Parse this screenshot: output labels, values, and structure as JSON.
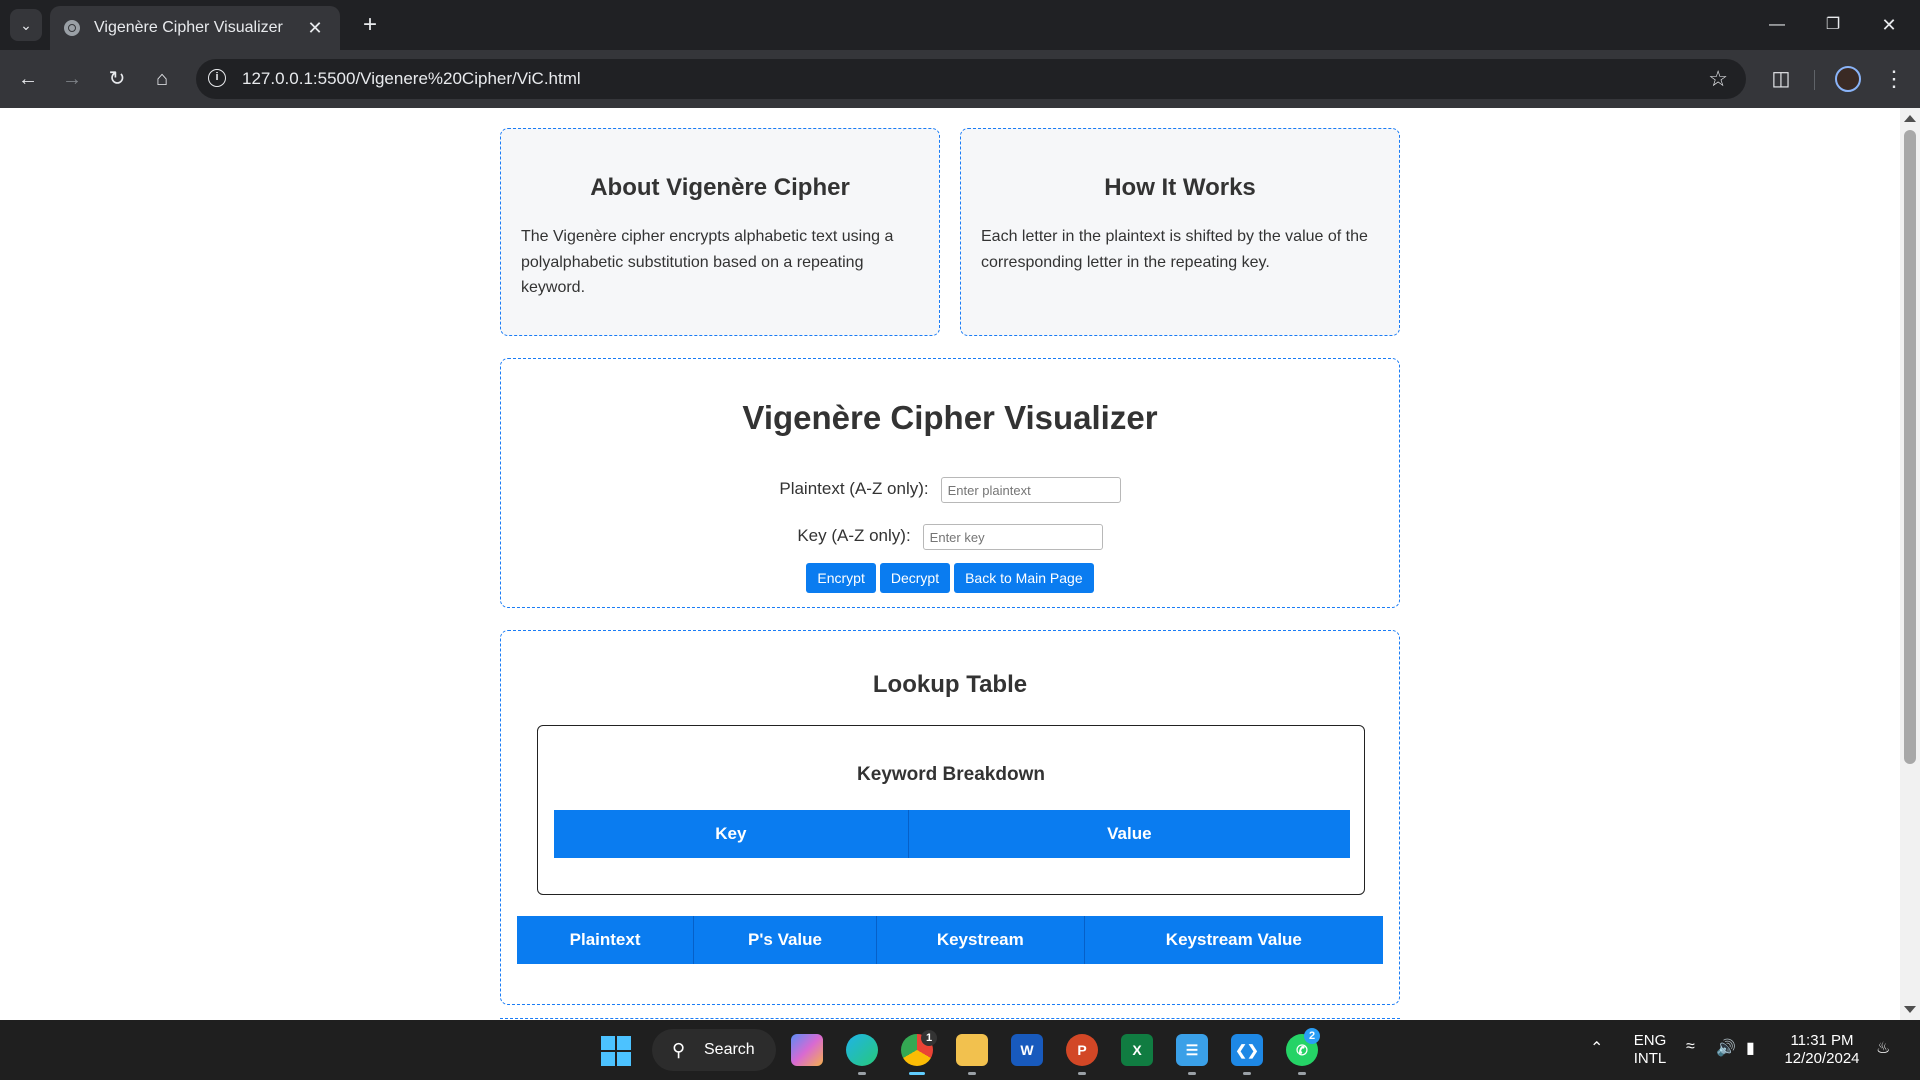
{
  "browser": {
    "tab_title": "Vigenère Cipher Visualizer",
    "url": "127.0.0.1:5500/Vigenere%20Cipher/ViC.html"
  },
  "about": {
    "title": "About Vigenère Cipher",
    "text": "The Vigenère cipher encrypts alphabetic text using a polyalphabetic substitution based on a repeating keyword."
  },
  "how": {
    "title": "How It Works",
    "text": "Each letter in the plaintext is shifted by the value of the corresponding letter in the repeating key."
  },
  "visualizer": {
    "title": "Vigenère Cipher Visualizer",
    "plaintext_label": "Plaintext (A-Z only):",
    "plaintext_placeholder": "Enter plaintext",
    "key_label": "Key (A-Z only):",
    "key_placeholder": "Enter key",
    "encrypt_label": "Encrypt",
    "decrypt_label": "Decrypt",
    "back_label": "Back to Main Page"
  },
  "lookup": {
    "title": "Lookup Table",
    "keyword_title": "Keyword Breakdown",
    "keyword_headers": [
      "Key",
      "Value"
    ],
    "main_headers": [
      "Plaintext",
      "P's Value",
      "Keystream",
      "Keystream Value"
    ]
  },
  "taskbar": {
    "search_label": "Search",
    "chrome_badge": "1",
    "whatsapp_badge": "2",
    "lang_line1": "ENG",
    "lang_line2": "INTL",
    "time": "11:31 PM",
    "date": "12/20/2024",
    "accent_color": "#0a7cf0"
  }
}
